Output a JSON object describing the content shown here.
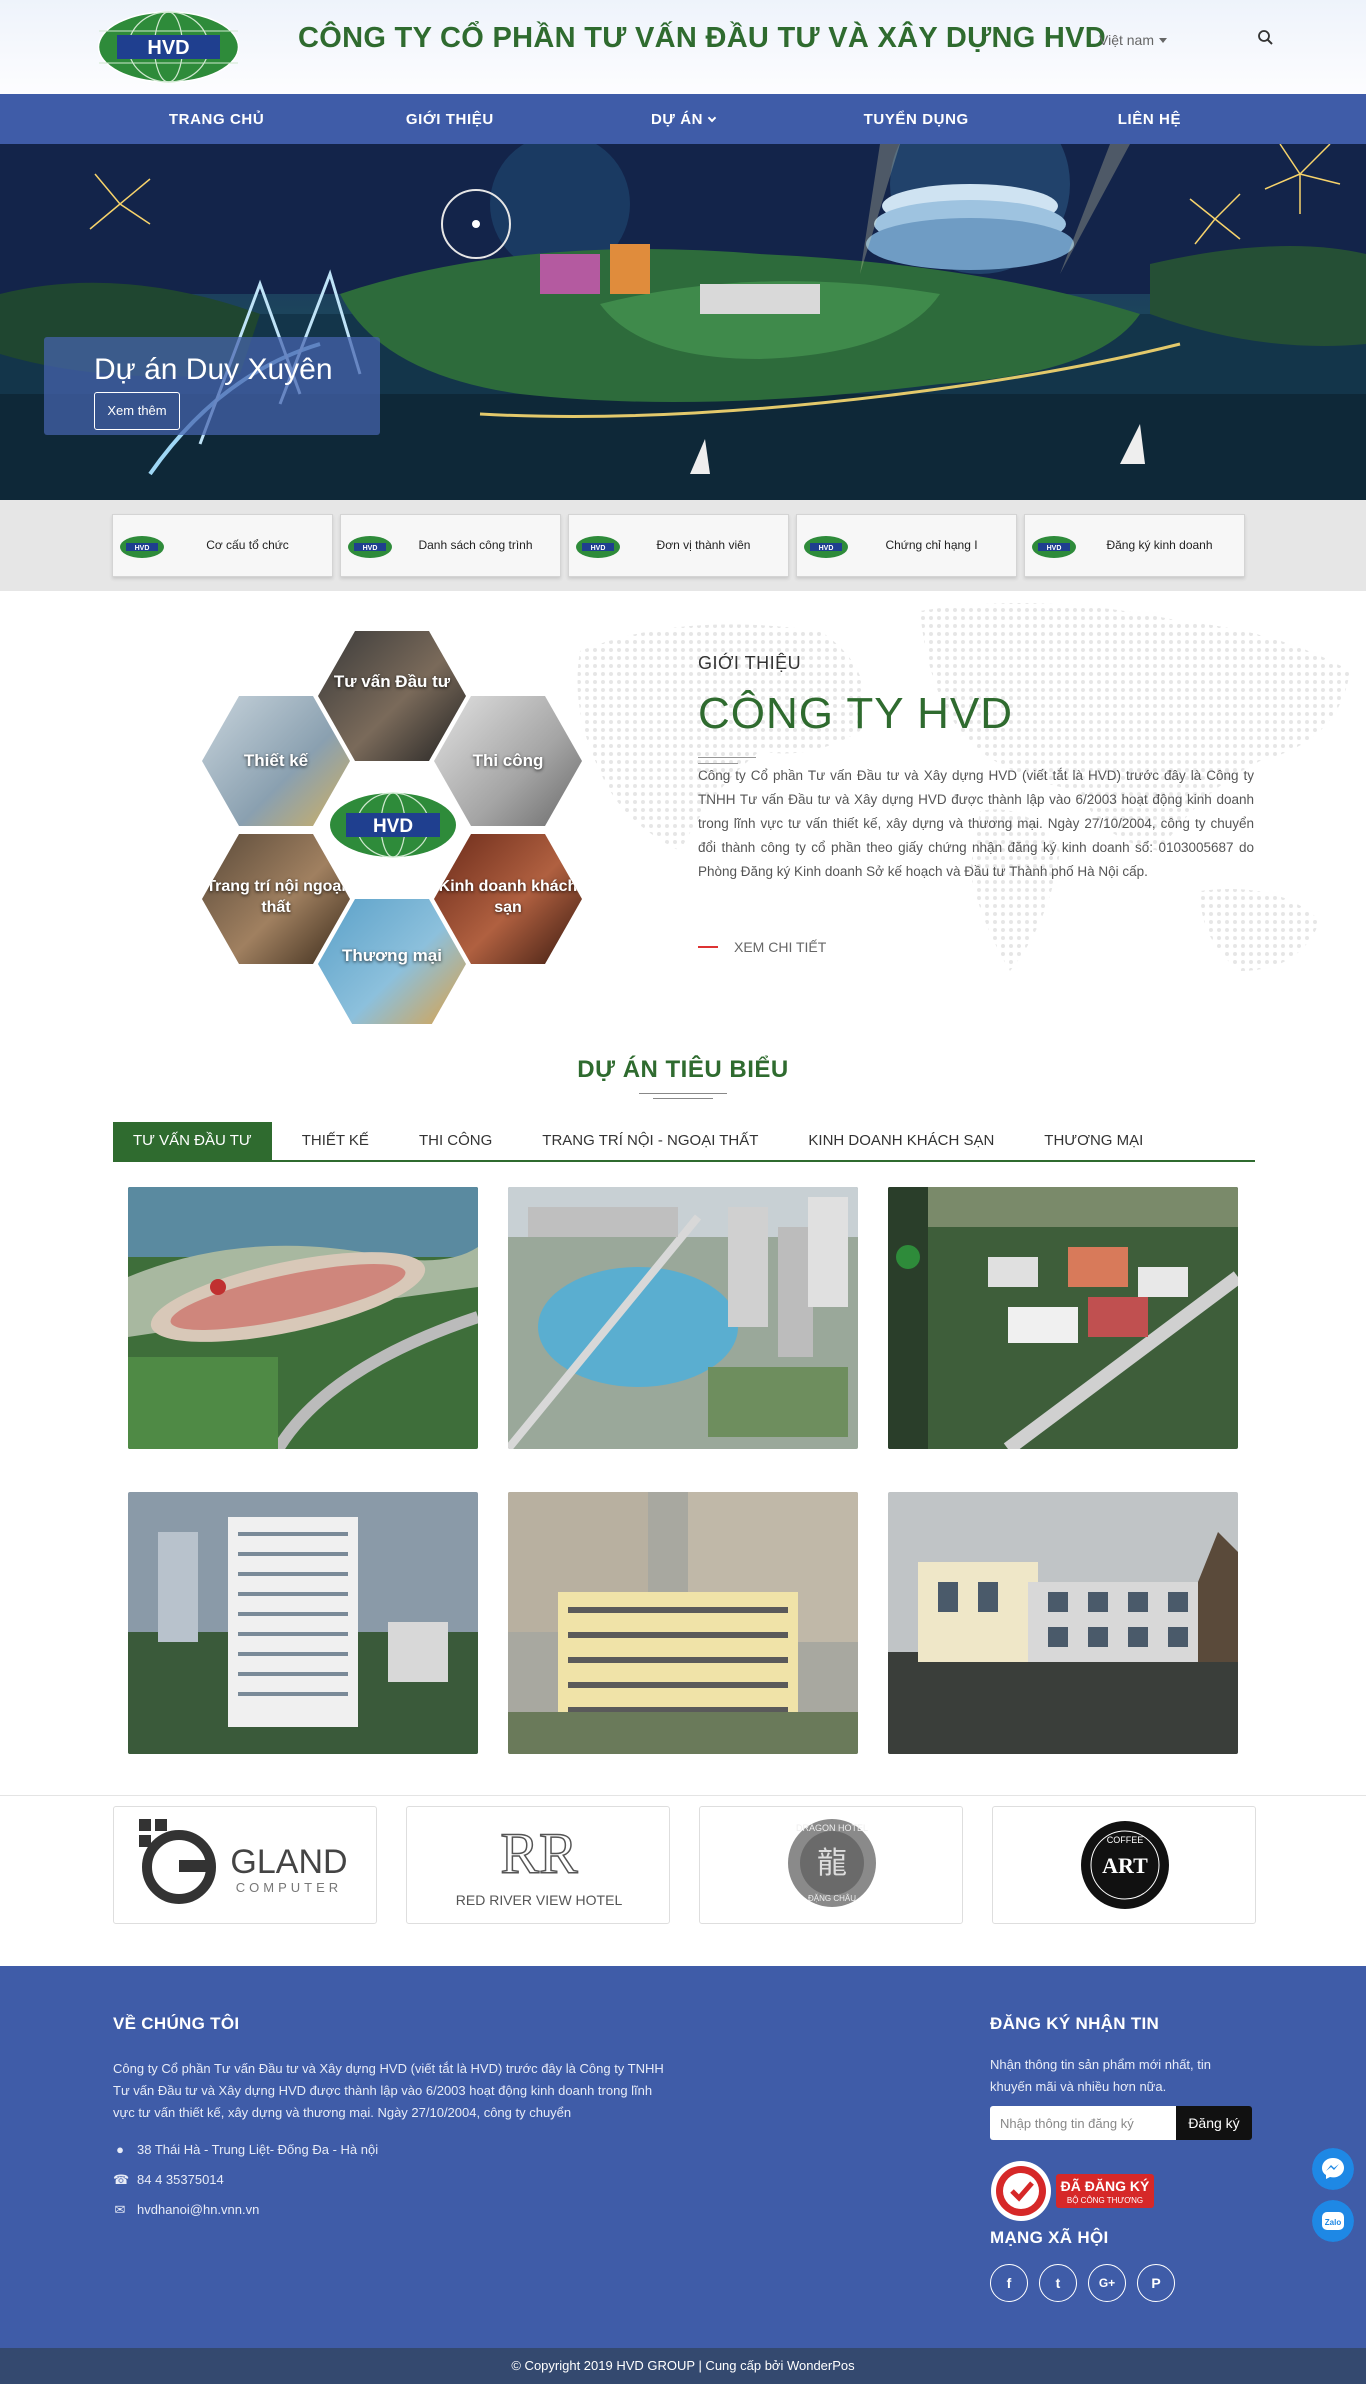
{
  "header": {
    "logo_text": "HVD",
    "company_name": "CÔNG TY CỔ PHẦN TƯ VẤN ĐẦU TƯ VÀ XÂY DỰNG HVD",
    "language": "Việt nam"
  },
  "nav": {
    "items": [
      {
        "label": "TRANG CHỦ"
      },
      {
        "label": "GIỚI THIỆU"
      },
      {
        "label": "DỰ ÁN"
      },
      {
        "label": "TUYỂN DỤNG"
      },
      {
        "label": "LIÊN HỆ"
      }
    ]
  },
  "hero": {
    "title": "Dự án Duy Xuyên",
    "button": "Xem thêm"
  },
  "quick_links": [
    {
      "label": "Cơ cấu tổ chức"
    },
    {
      "label": "Danh sách công trình"
    },
    {
      "label": "Đơn vị thành viên"
    },
    {
      "label": "Chứng chỉ hạng I"
    },
    {
      "label": "Đăng ký kinh doanh"
    }
  ],
  "intro": {
    "hexagons": [
      {
        "label": "Tư vấn Đầu tư"
      },
      {
        "label": "Thiết kế"
      },
      {
        "label": "Thi công"
      },
      {
        "label": "Trang trí nội ngoại thất"
      },
      {
        "label": "Kinh doanh khách sạn"
      },
      {
        "label": "Thương mại"
      }
    ],
    "kicker": "GIỚI THIỆU",
    "title": "CÔNG TY HVD",
    "text": "Công ty Cổ phần Tư vấn Đầu tư và Xây dựng HVD (viết tắt là HVD) trước đây là Công ty TNHH Tư vấn Đầu tư và Xây dựng HVD được thành lập vào 6/2003 hoạt động kinh doanh trong lĩnh vực tư vấn thiết kế, xây dựng và thương mại. Ngày 27/10/2004, công ty chuyển đổi thành công ty cổ phần theo giấy chứng nhận đăng ký kinh doanh số: 0103005687 do Phòng Đăng ký Kinh doanh Sở kế hoạch và Đầu tư Thành phố Hà Nội cấp.",
    "more": "XEM CHI TIẾT"
  },
  "projects": {
    "title": "DỰ ÁN TIÊU BIỂU",
    "tabs": [
      {
        "label": "TƯ VẤN ĐẦU TƯ",
        "active": true
      },
      {
        "label": "THIẾT KẾ"
      },
      {
        "label": "THI CÔNG"
      },
      {
        "label": "TRANG TRÍ NỘI - NGOẠI THẤT"
      },
      {
        "label": "KINH DOANH KHÁCH SẠN"
      },
      {
        "label": "THƯƠNG MẠI"
      }
    ]
  },
  "partners": [
    {
      "name": "GLAND",
      "sub": "COMPUTER"
    },
    {
      "name": "RR",
      "sub": "RED RIVER VIEW HOTEL"
    },
    {
      "name": "DRAGON HOTEL",
      "sub": "ĐẶNG CHÂU"
    },
    {
      "name": "ART",
      "sub": "COFFEE"
    }
  ],
  "footer": {
    "about_heading": "VỀ CHÚNG TÔI",
    "about_text": "Công ty Cổ phần Tư vấn Đầu tư và Xây dựng HVD (viết tắt là HVD) trước đây là Công ty TNHH Tư vấn Đầu tư và Xây dựng HVD được thành lập vào 6/2003 hoạt động kinh doanh trong lĩnh vực tư vấn thiết kế, xây dựng và thương mại. Ngày 27/10/2004, công ty chuyển",
    "address": "38 Thái Hà - Trung Liệt- Đống Đa - Hà nội",
    "phone": "84 4 35375014",
    "email": "hvdhanoi@hn.vnn.vn",
    "newsletter_heading": "ĐĂNG KÝ NHẬN TIN",
    "newsletter_text": "Nhận thông tin sản phẩm mới nhất, tin khuyến mãi và nhiều hơn nữa.",
    "newsletter_placeholder": "Nhập thông tin đăng ký",
    "newsletter_button": "Đăng ký",
    "badge_title": "ĐÃ ĐĂNG KÝ",
    "badge_sub": "BỘ CÔNG THƯƠNG",
    "social_heading": "MẠNG XÃ HỘI",
    "social": [
      {
        "icon": "facebook-icon",
        "glyph": "f"
      },
      {
        "icon": "twitter-icon",
        "glyph": "t"
      },
      {
        "icon": "google-plus-icon",
        "glyph": "G+"
      },
      {
        "icon": "pinterest-icon",
        "glyph": "P"
      }
    ],
    "copyright": "© Copyright 2019 HVD GROUP | Cung cấp bởi WonderPos"
  },
  "floating": {
    "zalo_label": "Zalo"
  },
  "colors": {
    "brand_green": "#2f6b2f",
    "nav_blue": "#3f5ca8",
    "footer_bar": "#34496f"
  }
}
